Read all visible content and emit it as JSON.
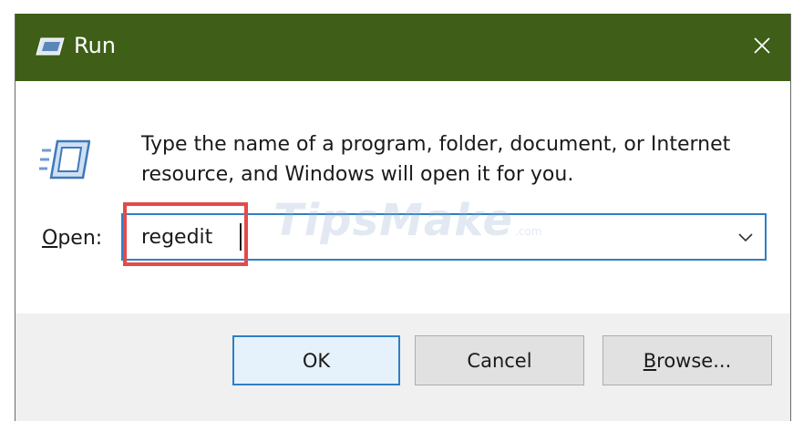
{
  "window": {
    "title": "Run",
    "icon": "run-dialog-icon",
    "close_icon": "close-icon",
    "accent_color": "#3f5e18"
  },
  "content": {
    "description": "Type the name of a program, folder, document, or Internet resource, and Windows will open it for you.",
    "open_label_accel": "O",
    "open_label_rest": "pen:",
    "input_value": "regedit",
    "dropdown_icon": "chevron-down-icon"
  },
  "buttons": {
    "ok": "OK",
    "cancel": "Cancel",
    "browse_accel": "B",
    "browse_rest": "rowse..."
  },
  "annotation": {
    "highlight_color": "#e44a4a"
  },
  "watermark": {
    "text": "TipsMake",
    "suffix": ".com"
  }
}
